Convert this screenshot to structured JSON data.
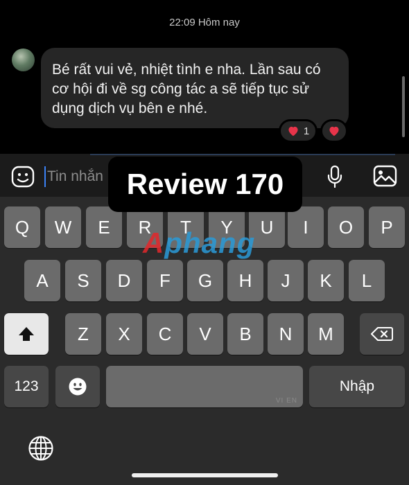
{
  "chat": {
    "timestamp": "22:09 Hôm nay",
    "message": "Bé rất vui vẻ, nhiệt tình e nha. Lần sau có cơ hội đi về sg công tác a sẽ tiếp tục sử dụng dịch vụ bên e nhé.",
    "reaction_count": "1"
  },
  "composer": {
    "placeholder": "Tin nhắn"
  },
  "overlay": {
    "badge_text": "Review 170",
    "watermark_a": "A",
    "watermark_b": "phang"
  },
  "keyboard": {
    "row1": [
      "Q",
      "W",
      "E",
      "R",
      "T",
      "Y",
      "U",
      "I",
      "O",
      "P"
    ],
    "row2": [
      "A",
      "S",
      "D",
      "F",
      "G",
      "H",
      "J",
      "K",
      "L"
    ],
    "row3": [
      "Z",
      "X",
      "C",
      "V",
      "B",
      "N",
      "M"
    ],
    "numbers_label": "123",
    "space_hint": "VI EN",
    "return_label": "Nhập"
  },
  "colors": {
    "accent_cursor": "#3b82f6",
    "reaction_heart": "#e8344a"
  },
  "icons": {
    "sticker": "smiley-sticker-icon",
    "mic": "microphone-icon",
    "gallery": "image-icon",
    "shift": "shift-arrow-icon",
    "delete": "backspace-icon",
    "emoji": "emoji-icon",
    "globe": "globe-icon"
  }
}
